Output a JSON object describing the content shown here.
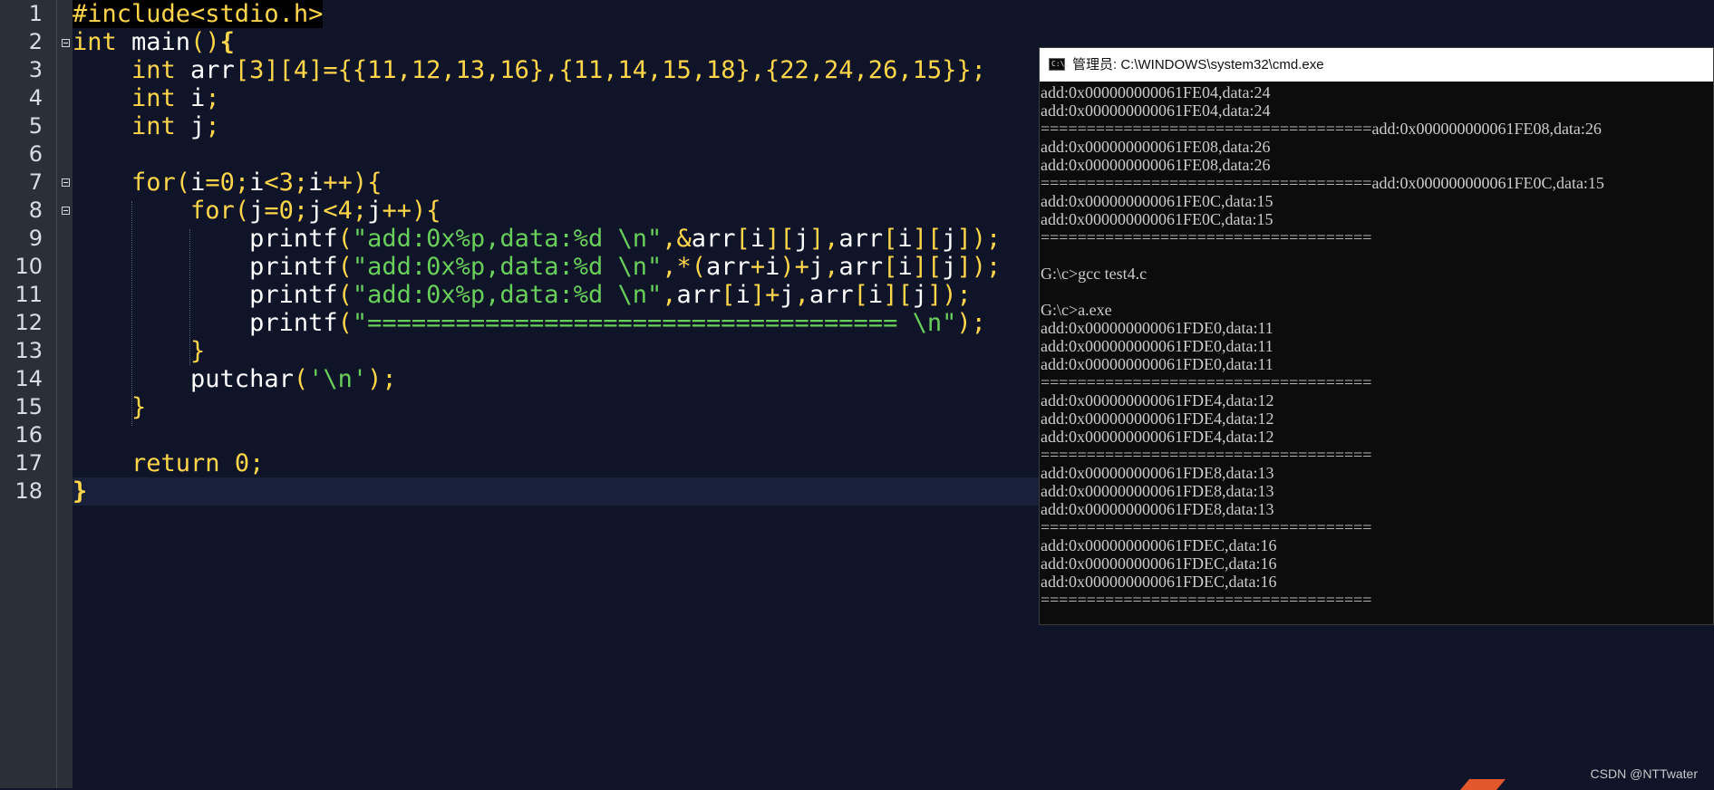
{
  "editor": {
    "line_numbers": [
      "1",
      "2",
      "3",
      "4",
      "5",
      "6",
      "7",
      "8",
      "9",
      "10",
      "11",
      "12",
      "13",
      "14",
      "15",
      "16",
      "17",
      "18"
    ],
    "lines": [
      [
        {
          "t": "#include<stdio.h>",
          "c": "pp"
        }
      ],
      [
        {
          "t": "int",
          "c": "kw"
        },
        {
          "t": " main",
          "c": "id"
        },
        {
          "t": "()",
          "c": "op"
        },
        {
          "t": "{",
          "c": "brace"
        }
      ],
      [
        {
          "t": "    int",
          "c": "kw"
        },
        {
          "t": " arr",
          "c": "id"
        },
        {
          "t": "[3][4]={{11,12,13,16},{11,14,15,18},{22,24,26,15}};",
          "c": "num"
        }
      ],
      [
        {
          "t": "    int",
          "c": "kw"
        },
        {
          "t": " i",
          "c": "id"
        },
        {
          "t": ";",
          "c": "op"
        }
      ],
      [
        {
          "t": "    int",
          "c": "kw"
        },
        {
          "t": " j",
          "c": "id"
        },
        {
          "t": ";",
          "c": "op"
        }
      ],
      [],
      [
        {
          "t": "    for",
          "c": "kw"
        },
        {
          "t": "(",
          "c": "op"
        },
        {
          "t": "i",
          "c": "id"
        },
        {
          "t": "=0;",
          "c": "op"
        },
        {
          "t": "i",
          "c": "id"
        },
        {
          "t": "<3;",
          "c": "op"
        },
        {
          "t": "i",
          "c": "id"
        },
        {
          "t": "++){",
          "c": "op"
        }
      ],
      [
        {
          "t": "        for",
          "c": "kw"
        },
        {
          "t": "(",
          "c": "op"
        },
        {
          "t": "j",
          "c": "id"
        },
        {
          "t": "=0;",
          "c": "op"
        },
        {
          "t": "j",
          "c": "id"
        },
        {
          "t": "<4;",
          "c": "op"
        },
        {
          "t": "j",
          "c": "id"
        },
        {
          "t": "++){",
          "c": "op"
        }
      ],
      [
        {
          "t": "            printf",
          "c": "id"
        },
        {
          "t": "(",
          "c": "op"
        },
        {
          "t": "\"add:0x%p,data:%d \\n\"",
          "c": "str"
        },
        {
          "t": ",&",
          "c": "op"
        },
        {
          "t": "arr",
          "c": "id"
        },
        {
          "t": "[",
          "c": "op"
        },
        {
          "t": "i",
          "c": "id"
        },
        {
          "t": "][",
          "c": "op"
        },
        {
          "t": "j",
          "c": "id"
        },
        {
          "t": "],",
          "c": "op"
        },
        {
          "t": "arr",
          "c": "id"
        },
        {
          "t": "[",
          "c": "op"
        },
        {
          "t": "i",
          "c": "id"
        },
        {
          "t": "][",
          "c": "op"
        },
        {
          "t": "j",
          "c": "id"
        },
        {
          "t": "]);",
          "c": "op"
        }
      ],
      [
        {
          "t": "            printf",
          "c": "id"
        },
        {
          "t": "(",
          "c": "op"
        },
        {
          "t": "\"add:0x%p,data:%d \\n\"",
          "c": "str"
        },
        {
          "t": ",*(",
          "c": "op"
        },
        {
          "t": "arr",
          "c": "id"
        },
        {
          "t": "+",
          "c": "op"
        },
        {
          "t": "i",
          "c": "id"
        },
        {
          "t": ")+",
          "c": "op"
        },
        {
          "t": "j",
          "c": "id"
        },
        {
          "t": ",",
          "c": "op"
        },
        {
          "t": "arr",
          "c": "id"
        },
        {
          "t": "[",
          "c": "op"
        },
        {
          "t": "i",
          "c": "id"
        },
        {
          "t": "][",
          "c": "op"
        },
        {
          "t": "j",
          "c": "id"
        },
        {
          "t": "]);",
          "c": "op"
        }
      ],
      [
        {
          "t": "            printf",
          "c": "id"
        },
        {
          "t": "(",
          "c": "op"
        },
        {
          "t": "\"add:0x%p,data:%d \\n\"",
          "c": "str"
        },
        {
          "t": ",",
          "c": "op"
        },
        {
          "t": "arr",
          "c": "id"
        },
        {
          "t": "[",
          "c": "op"
        },
        {
          "t": "i",
          "c": "id"
        },
        {
          "t": "]+",
          "c": "op"
        },
        {
          "t": "j",
          "c": "id"
        },
        {
          "t": ",",
          "c": "op"
        },
        {
          "t": "arr",
          "c": "id"
        },
        {
          "t": "[",
          "c": "op"
        },
        {
          "t": "i",
          "c": "id"
        },
        {
          "t": "][",
          "c": "op"
        },
        {
          "t": "j",
          "c": "id"
        },
        {
          "t": "]);",
          "c": "op"
        }
      ],
      [
        {
          "t": "            printf",
          "c": "id"
        },
        {
          "t": "(",
          "c": "op"
        },
        {
          "t": "\"==================================== \\n\"",
          "c": "str"
        },
        {
          "t": ");",
          "c": "op"
        }
      ],
      [
        {
          "t": "        }",
          "c": "op"
        }
      ],
      [
        {
          "t": "        putchar",
          "c": "id"
        },
        {
          "t": "(",
          "c": "op"
        },
        {
          "t": "'\\n'",
          "c": "str"
        },
        {
          "t": ");",
          "c": "op"
        }
      ],
      [
        {
          "t": "    }",
          "c": "op"
        }
      ],
      [],
      [
        {
          "t": "    return",
          "c": "kw"
        },
        {
          "t": " 0;",
          "c": "num"
        }
      ],
      [
        {
          "t": "}",
          "c": "brace"
        }
      ]
    ]
  },
  "cmd": {
    "title": "管理员: C:\\WINDOWS\\system32\\cmd.exe",
    "icon": "cmd-window-icon",
    "icon_text": "C:\\.",
    "lines": [
      "add:0x000000000061FE04,data:24",
      "add:0x000000000061FE04,data:24",
      "====================================add:0x000000000061FE08,data:26",
      "add:0x000000000061FE08,data:26",
      "add:0x000000000061FE08,data:26",
      "====================================add:0x000000000061FE0C,data:15",
      "add:0x000000000061FE0C,data:15",
      "add:0x000000000061FE0C,data:15",
      "====================================",
      "",
      "G:\\c>gcc test4.c",
      "",
      "G:\\c>a.exe",
      "add:0x000000000061FDE0,data:11",
      "add:0x000000000061FDE0,data:11",
      "add:0x000000000061FDE0,data:11",
      "====================================",
      "add:0x000000000061FDE4,data:12",
      "add:0x000000000061FDE4,data:12",
      "add:0x000000000061FDE4,data:12",
      "====================================",
      "add:0x000000000061FDE8,data:13",
      "add:0x000000000061FDE8,data:13",
      "add:0x000000000061FDE8,data:13",
      "====================================",
      "add:0x000000000061FDEC,data:16",
      "add:0x000000000061FDEC,data:16",
      "add:0x000000000061FDEC,data:16",
      "===================================="
    ]
  },
  "watermark": "CSDN @NTTwater",
  "colors": {
    "editor_bg": "#0f1429",
    "gutter_bg": "#2b3038",
    "keyword": "#ffd54a",
    "string": "#68d05a",
    "identifier": "#ffffff",
    "console_bg": "#0c0c0c",
    "console_text": "#cccccc"
  }
}
